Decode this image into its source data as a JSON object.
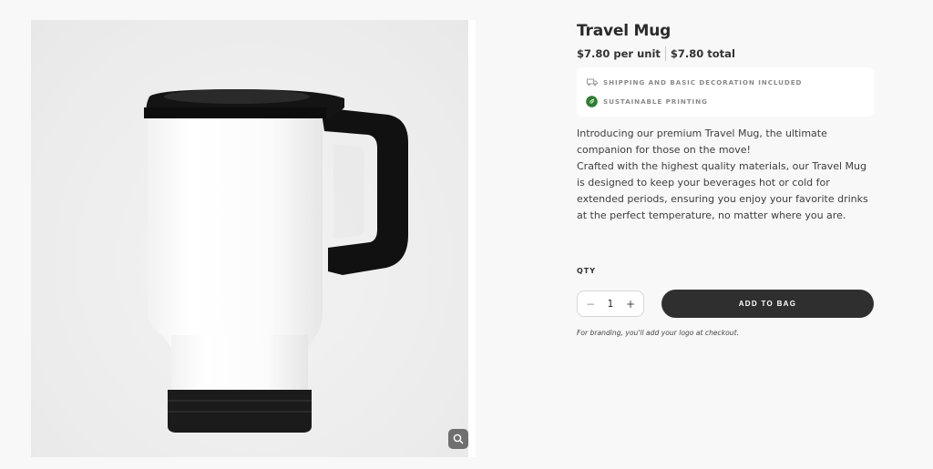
{
  "product": {
    "title": "Travel Mug",
    "price_per_unit": "$7.80 per unit",
    "price_total": "$7.80 total",
    "perks": [
      {
        "icon": "truck-icon",
        "label": "SHIPPING AND BASIC DECORATION INCLUDED"
      },
      {
        "icon": "leaf-icon",
        "label": "SUSTAINABLE PRINTING"
      }
    ],
    "description_lines": [
      "Introducing our premium Travel Mug, the ultimate",
      "companion for those on the move!",
      "Crafted with the highest quality materials, our Travel Mug",
      "is designed to keep your beverages hot or cold for",
      "extended periods, ensuring you enjoy your favorite drinks",
      "at the perfect temperature, no matter where you are."
    ]
  },
  "purchase": {
    "qty_label": "QTY",
    "quantity": "1",
    "minus": "−",
    "plus": "+",
    "add_to_bag": "ADD TO BAG",
    "branding_note": "For branding, you'll add your logo at checkout."
  },
  "gallery": {
    "zoom_icon": "magnifier-icon",
    "image": "travel-mug-image"
  },
  "colors": {
    "button_dark": "#2f2f2f",
    "leaf_green": "#2e7d32",
    "page_bg": "#f8f8f8"
  }
}
